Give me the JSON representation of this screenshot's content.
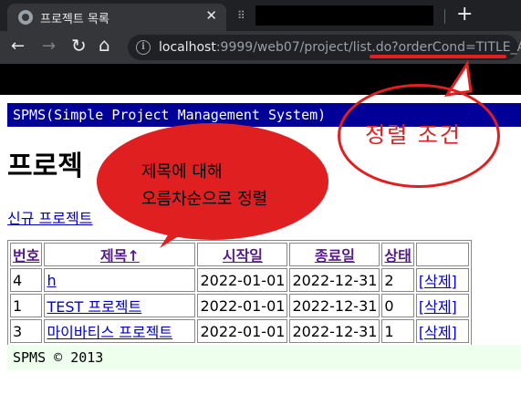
{
  "browser": {
    "tab_title": "프로젝트 목록",
    "tab_close": "✕",
    "new_tab": "+",
    "url_host": "localhost",
    "url_rest": ":9999/web07/project/list.do?orderCond=TITLE_ASC",
    "back": "←",
    "forward": "→",
    "reload": "↻",
    "home": "⌂",
    "info": "i"
  },
  "page": {
    "header": "SPMS(Simple Project Management System)",
    "title": "프로젝",
    "new_project_link": "신규 프로젝트",
    "footer": "SPMS © 2013"
  },
  "table": {
    "headers": [
      "번호",
      "제목↑",
      "시작일",
      "종료일",
      "상태",
      ""
    ],
    "rows": [
      {
        "no": "4",
        "title": "h",
        "start": "2022-01-01",
        "end": "2022-12-31",
        "state": "2",
        "delete": "[삭제]"
      },
      {
        "no": "1",
        "title": "TEST 프로젝트",
        "start": "2022-01-01",
        "end": "2022-12-31",
        "state": "0",
        "delete": "[삭제]"
      },
      {
        "no": "3",
        "title": "마이바티스 프로젝트",
        "start": "2022-01-01",
        "end": "2022-12-31",
        "state": "1",
        "delete": "[삭제]"
      }
    ]
  },
  "annotations": {
    "bubble_line1": "제목에 대해",
    "bubble_line2": "오름차순으로 정렬",
    "oval_label": "정렬 조건",
    "color": "#e02020"
  }
}
